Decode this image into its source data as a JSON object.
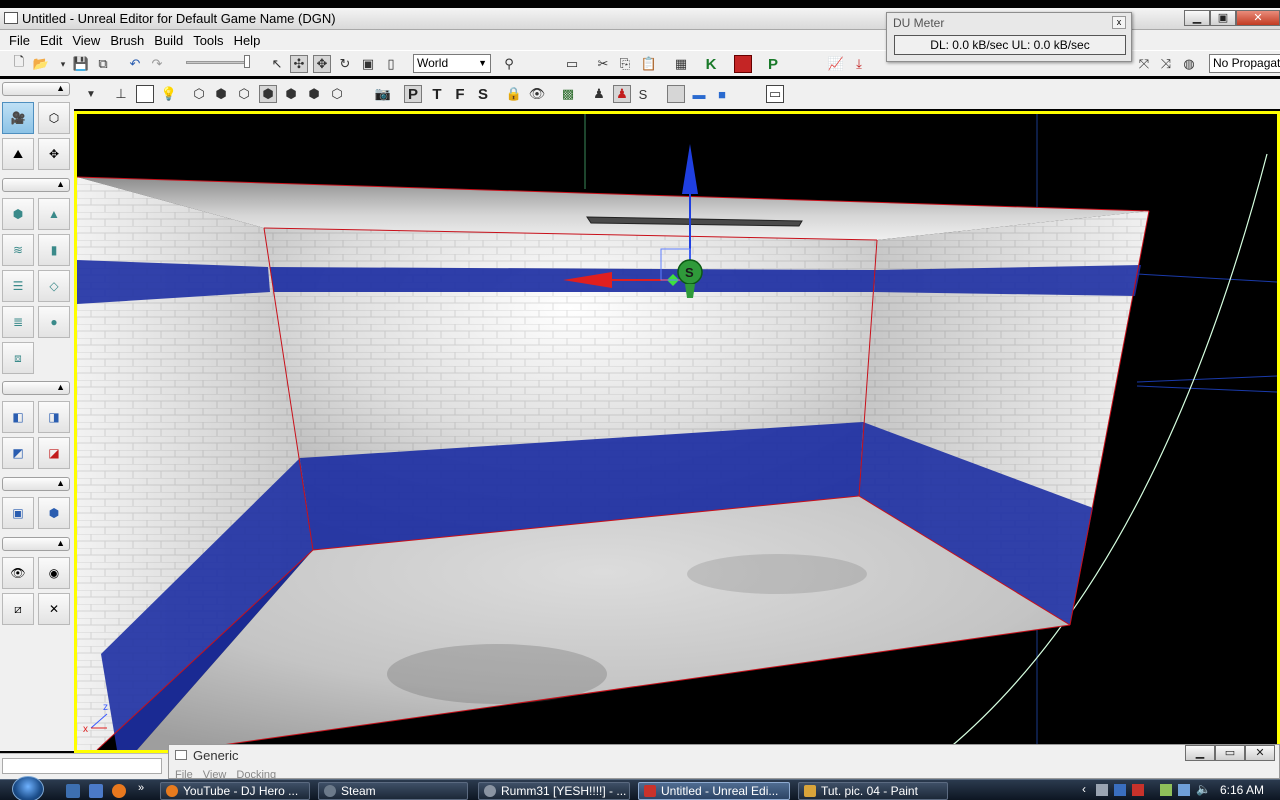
{
  "window": {
    "title": "Untitled - Unreal Editor for Default Game Name (DGN)"
  },
  "menu": [
    "File",
    "Edit",
    "View",
    "Brush",
    "Build",
    "Tools",
    "Help"
  ],
  "toolbar": {
    "coordinate_system": "World",
    "propagation": "No Propagatio",
    "letters": [
      "K",
      "P"
    ]
  },
  "toolbar2": {
    "letters": [
      "P",
      "T",
      "F",
      "S"
    ],
    "show_s": "S"
  },
  "du_meter": {
    "title": "DU Meter",
    "close": "x",
    "readout": "DL: 0.0 kB/sec  UL: 0.0 kB/sec"
  },
  "viewport": {
    "axis_x": "x",
    "axis_z": "z",
    "light_label": "S"
  },
  "generic_window": {
    "title": "Generic",
    "menu": [
      "File",
      "View",
      "Docking"
    ]
  },
  "taskbar": {
    "items": [
      {
        "label": "YouTube - DJ Hero ...",
        "color": "#e87b1e"
      },
      {
        "label": "Steam",
        "color": "#6c7a8a"
      },
      {
        "label": "Rumm31 [YESH!!!!] - ...",
        "color": "#8a94a2"
      },
      {
        "label": "Untitled - Unreal Edi...",
        "color": "#c8322b"
      },
      {
        "label": "Tut. pic. 04 - Paint",
        "color": "#d9a43a"
      }
    ],
    "clock": "6:16 AM"
  },
  "colors": {
    "viewport_border": "#ffff00",
    "wall_stripe": "#1d2fa3",
    "selection_outline": "#c8101a"
  }
}
